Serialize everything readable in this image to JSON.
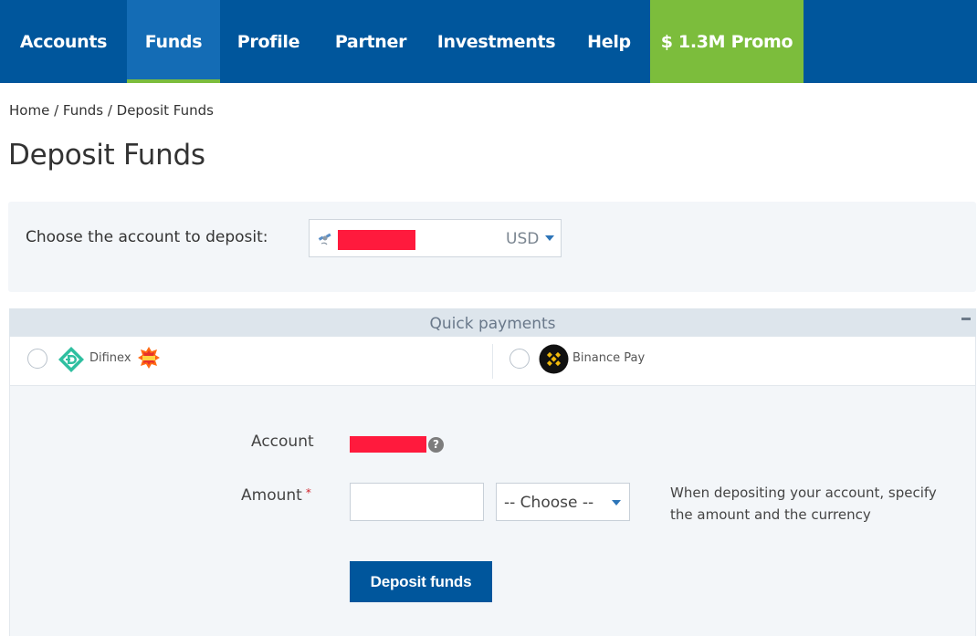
{
  "nav": {
    "items": [
      {
        "label": "Accounts"
      },
      {
        "label": "Funds"
      },
      {
        "label": "Profile"
      },
      {
        "label": "Partner"
      },
      {
        "label": "Investments"
      },
      {
        "label": "Help"
      },
      {
        "label": "$ 1.3M Promo"
      }
    ],
    "active": "Funds",
    "colors": {
      "bar": "#00569c",
      "active": "#146cb5",
      "promo": "#7cbd3c"
    }
  },
  "breadcrumb": [
    "Home",
    "Funds",
    "Deposit Funds"
  ],
  "breadcrumb_separator": " / ",
  "page_title": "Deposit Funds",
  "account_select": {
    "label": "Choose the account to deposit:",
    "currency": "USD",
    "icon": "satellite-icon"
  },
  "quick_payments": {
    "title": "Quick payments",
    "methods": [
      {
        "name": "Difinex",
        "icon": "difinex-logo-icon",
        "badge_icon": "new-badge-icon"
      },
      {
        "name": "Binance Pay",
        "icon": "binance-logo-icon"
      }
    ]
  },
  "form": {
    "account_label": "Account",
    "amount_label": "Amount",
    "required_mark": "*",
    "amount_value": "",
    "currency_selected": "-- Choose --",
    "hint": "When depositing your account, specify the amount and the currency",
    "help_symbol": "?",
    "submit_label": "Deposit funds"
  }
}
